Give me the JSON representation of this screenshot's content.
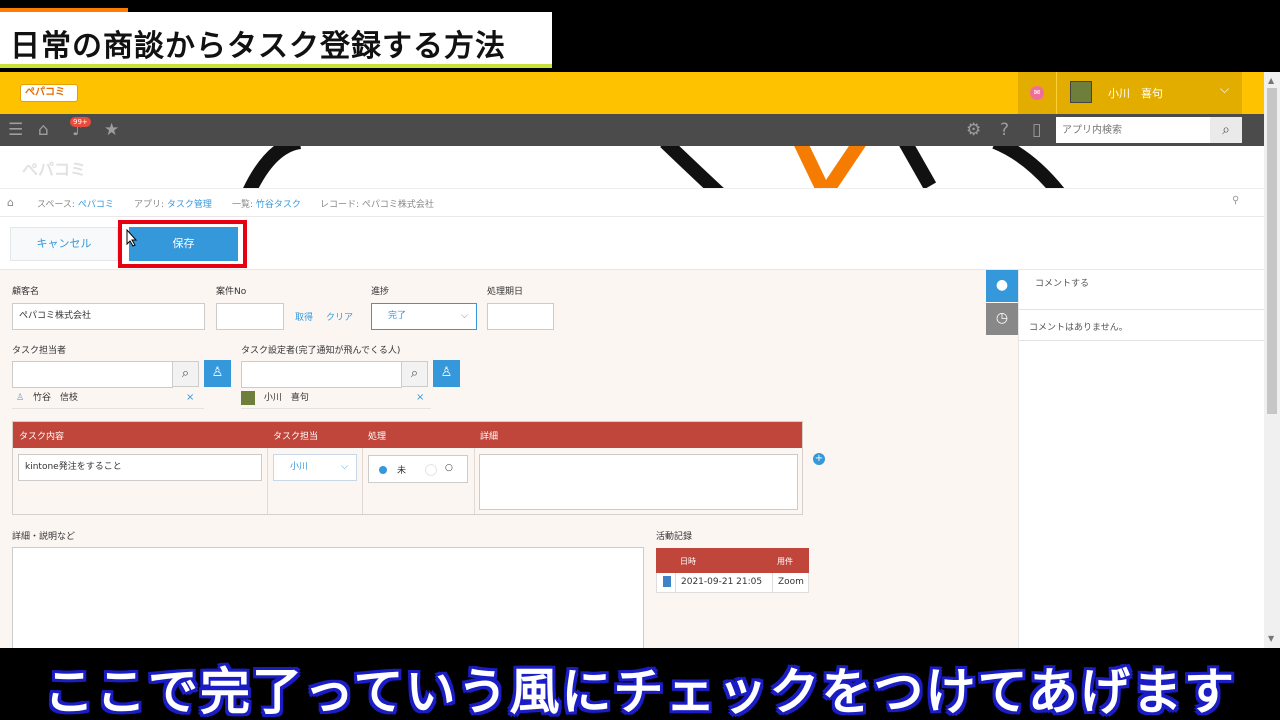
{
  "video": {
    "title": "日常の商談からタスク登録する方法",
    "caption": "ここで完了っていう風にチェックをつけてあげます"
  },
  "header": {
    "logo_text": "ぺパコミ",
    "user_name": "小川　喜句",
    "notification_count": "99+"
  },
  "toolbar": {
    "search_placeholder": "アプリ内検索"
  },
  "space": {
    "banner_text": "ぺパコミ"
  },
  "breadcrumb": [
    {
      "prefix": "スペース: ",
      "link": "ぺパコミ"
    },
    {
      "prefix": "アプリ: ",
      "link": "タスク管理"
    },
    {
      "prefix": "一覧: ",
      "link": "竹谷タスク"
    },
    {
      "prefix": "レコード: ",
      "link": "ぺパコミ株式会社"
    }
  ],
  "actions": {
    "cancel_label": "キャンセル",
    "save_label": "保存"
  },
  "form": {
    "customer_label": "顧客名",
    "customer_value": "ぺパコミ株式会社",
    "case_no_label": "案件No",
    "case_no_value": "",
    "get_label": "取得",
    "clear_label": "クリア",
    "progress_label": "進捗",
    "progress_value": "完了",
    "due_label": "処理期日",
    "due_value": "",
    "task_owner_label": "タスク担当者",
    "task_owner_user": "竹谷　信枝",
    "task_setter_label": "タスク設定者(完了通知が飛んでくる人)",
    "task_setter_user": "小川　喜句"
  },
  "subtable": {
    "headers": [
      "タスク内容",
      "タスク担当",
      "処理",
      "詳細"
    ],
    "rows": [
      {
        "content": "kintone発注をすること",
        "assignee": "小川",
        "radio_selected": "未",
        "radio_other": "○",
        "detail": ""
      }
    ]
  },
  "details": {
    "label": "詳細・説明など"
  },
  "activity": {
    "label": "活動記録",
    "headers": [
      "日時",
      "用件"
    ],
    "rows": [
      {
        "datetime": "2021-09-21 21:05",
        "purpose": "Zoom"
      }
    ]
  },
  "comments": {
    "input_placeholder": "コメントする",
    "empty_text": "コメントはありません。"
  },
  "colors": {
    "header_yellow": "#ffc200",
    "toolbar_gray": "#4b4b4b",
    "accent_blue": "#3498db",
    "table_header_red": "#c0463b",
    "highlight_red": "#e60012"
  }
}
